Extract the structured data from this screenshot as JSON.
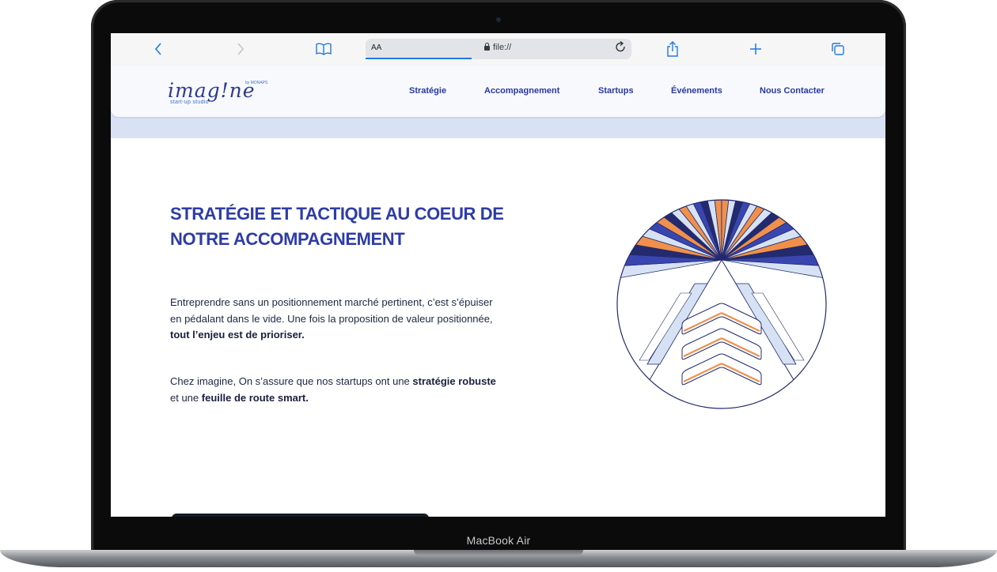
{
  "device": {
    "label": "MacBook Air"
  },
  "browser": {
    "text_size_label": "AA",
    "url": "file://",
    "icons": {
      "back": "chevron-left-icon",
      "forward": "chevron-right-icon",
      "bookmarks": "book-icon",
      "reload": "reload-icon",
      "share": "share-icon",
      "new_tab": "plus-icon",
      "tabs": "tabs-icon"
    }
  },
  "site": {
    "logo": {
      "script": "imag!ne",
      "by": "by MONAPS",
      "tagline": "start-up studio"
    },
    "nav": [
      {
        "label": "Stratégie"
      },
      {
        "label": "Accompagnement"
      },
      {
        "label": "Startups"
      },
      {
        "label": "Événements"
      },
      {
        "label": "Nous Contacter"
      }
    ]
  },
  "content": {
    "headline_line1": "STRATÉGIE ET TACTIQUE AU COEUR DE",
    "headline_line2": "NOTRE ACCOMPAGNEMENT",
    "para1_line1": "Entreprendre sans un positionnement marché pertinent, c’est s’épuiser",
    "para1_line2": "en pédalant dans le vide. Une fois la proposition de valeur positionnée,",
    "para1_bold": "tout l’enjeu est de prioriser.",
    "para2_lead": "Chez imagine, On s’assure que nos startups ont une ",
    "para2_bold1": "stratégie robuste",
    "para2_mid": "et une ",
    "para2_bold2": "feuille de route smart."
  },
  "colors": {
    "navy": "#232a6e",
    "royal_blue": "#3a46b0",
    "orange": "#f0904a",
    "pale_blue": "#d6e2f3",
    "heading_blue": "#2e3ca6",
    "header_band": "#d8e2f4",
    "browser_accent": "#1f7ae0"
  }
}
